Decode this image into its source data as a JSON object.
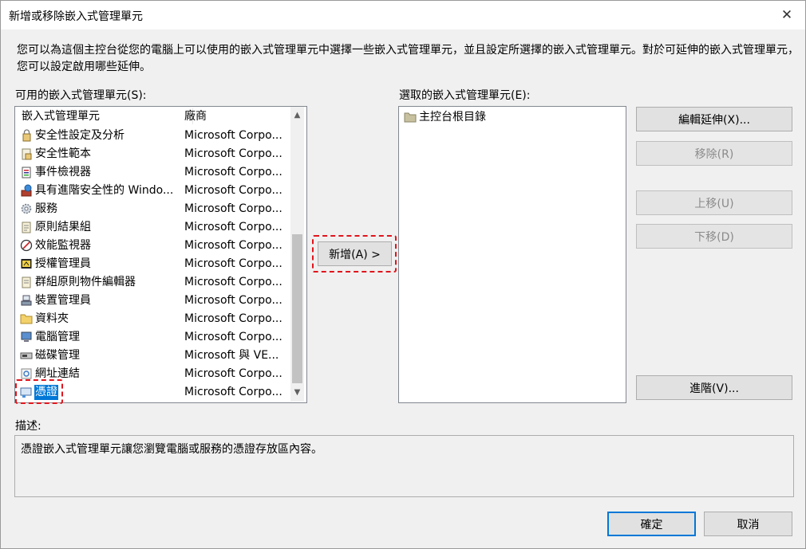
{
  "window": {
    "title": "新增或移除嵌入式管理單元",
    "close_glyph": "✕"
  },
  "intro": "您可以為這個主控台從您的電腦上可以使用的嵌入式管理單元中選擇一些嵌入式管理單元，並且設定所選擇的嵌入式管理單元。對於可延伸的嵌入式管理單元，您可以設定啟用哪些延伸。",
  "available": {
    "label": "可用的嵌入式管理單元(S):",
    "col_name": "嵌入式管理單元",
    "col_vendor": "廠商",
    "items": [
      {
        "name": "安全性設定及分析",
        "vendor": "Microsoft Corpo...",
        "icon": "security-analysis-icon"
      },
      {
        "name": "安全性範本",
        "vendor": "Microsoft Corpo...",
        "icon": "security-template-icon"
      },
      {
        "name": "事件檢視器",
        "vendor": "Microsoft Corpo...",
        "icon": "event-viewer-icon"
      },
      {
        "name": "具有進階安全性的 Windo...",
        "vendor": "Microsoft Corpo...",
        "icon": "firewall-icon"
      },
      {
        "name": "服務",
        "vendor": "Microsoft Corpo...",
        "icon": "services-gear-icon"
      },
      {
        "name": "原則結果組",
        "vendor": "Microsoft Corpo...",
        "icon": "policy-result-icon"
      },
      {
        "name": "效能監視器",
        "vendor": "Microsoft Corpo...",
        "icon": "performance-monitor-icon"
      },
      {
        "name": "授權管理員",
        "vendor": "Microsoft Corpo...",
        "icon": "authorization-manager-icon"
      },
      {
        "name": "群組原則物件編輯器",
        "vendor": "Microsoft Corpo...",
        "icon": "group-policy-icon"
      },
      {
        "name": "裝置管理員",
        "vendor": "Microsoft Corpo...",
        "icon": "device-manager-icon"
      },
      {
        "name": "資料夾",
        "vendor": "Microsoft Corpo...",
        "icon": "folder-icon"
      },
      {
        "name": "電腦管理",
        "vendor": "Microsoft Corpo...",
        "icon": "computer-management-icon"
      },
      {
        "name": "磁碟管理",
        "vendor": "Microsoft 與 VE...",
        "icon": "disk-management-icon"
      },
      {
        "name": "網址連結",
        "vendor": "Microsoft Corpo...",
        "icon": "link-icon"
      },
      {
        "name": "憑證",
        "vendor": "Microsoft Corpo...",
        "icon": "certificate-icon",
        "selected": true
      }
    ]
  },
  "add_button": "新增(A) >",
  "selected": {
    "label": "選取的嵌入式管理單元(E):",
    "items": [
      {
        "name": "主控台根目錄",
        "icon": "console-root-folder-icon"
      }
    ]
  },
  "buttons": {
    "edit_ext": "編輯延伸(X)...",
    "remove": "移除(R)",
    "move_up": "上移(U)",
    "move_down": "下移(D)",
    "advanced": "進階(V)...",
    "ok": "確定",
    "cancel": "取消"
  },
  "description": {
    "label": "描述:",
    "text": "憑證嵌入式管理單元讓您瀏覽電腦或服務的憑證存放區內容。"
  },
  "colors": {
    "selection": "#0078d7",
    "highlight_dash": "#e0141c"
  }
}
